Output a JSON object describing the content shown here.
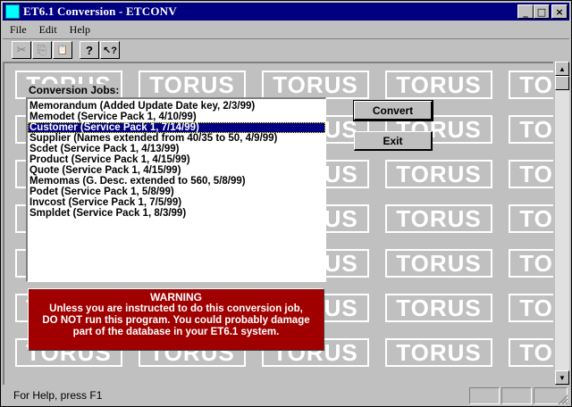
{
  "window": {
    "title": "ET6.1 Conversion - ETCONV",
    "minimize": "_",
    "maximize": "□",
    "close": "×"
  },
  "menu": {
    "items": [
      {
        "label": "File",
        "mnemonic": "F"
      },
      {
        "label": "Edit",
        "mnemonic": "E"
      },
      {
        "label": "Help",
        "mnemonic": "H"
      }
    ]
  },
  "toolbar": {
    "cut": "✂",
    "copy": "⎘",
    "paste": "📋",
    "help": "?",
    "context_help": "↖?"
  },
  "background": {
    "tile_text": "TORUS"
  },
  "jobs": {
    "label": "Conversion Jobs:",
    "items": [
      "Memorandum (Added Update Date key, 2/3/99)",
      "Memodet (Service Pack 1, 4/10/99)",
      "Customer (Service Pack 1, 7/14/99)",
      "Supplier (Names extended from 40/35 to 50, 4/9/99)",
      "Scdet (Service Pack 1, 4/13/99)",
      "Product (Service Pack 1, 4/15/99)",
      "Quote (Service Pack 1, 4/15/99)",
      "Memomas (G. Desc. extended to 560, 5/8/99)",
      "Podet (Service Pack 1, 5/8/99)",
      "Invcost (Service Pack 1, 7/5/99)",
      "Smpldet (Service Pack 1, 8/3/99)"
    ],
    "selected_index": 2
  },
  "buttons": {
    "convert": "Convert",
    "exit": "Exit"
  },
  "warning": {
    "title": "WARNING",
    "line1": "Unless you are instructed to do this conversion job,",
    "line2": "DO NOT run this program. You could probably damage",
    "line3": "part of the database in your ET6.1 system."
  },
  "status": {
    "text": "For Help, press F1"
  },
  "colors": {
    "titlebar": "#000080",
    "warning_bg": "#a00000",
    "selection": "#000080"
  }
}
